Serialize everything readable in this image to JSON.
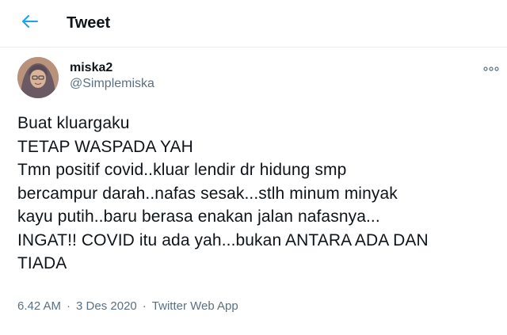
{
  "header": {
    "title": "Tweet",
    "back_icon": "arrow-left-icon"
  },
  "colors": {
    "accent": "#1da1f2",
    "text_primary": "#0f1419",
    "text_secondary": "#5b7083",
    "divider": "#e6ecf0"
  },
  "tweet": {
    "author": {
      "display_name": "miska2",
      "handle": "@Simplemiska"
    },
    "more_icon": "more-horizontal-icon",
    "text": "Buat kluargaku\nTETAP WASPADA YAH\nTmn positif covid..kluar lendir dr hidung smp\nbercampur darah..nafas sesak...stlh minum minyak\nkayu putih..baru berasa enakan jalan nafasnya...\nINGAT!! COVID itu ada yah...bukan ANTARA ADA DAN\nTIADA",
    "time": "6.42 AM",
    "separator": "·",
    "date": "3 Des 2020",
    "source": "Twitter Web App"
  }
}
